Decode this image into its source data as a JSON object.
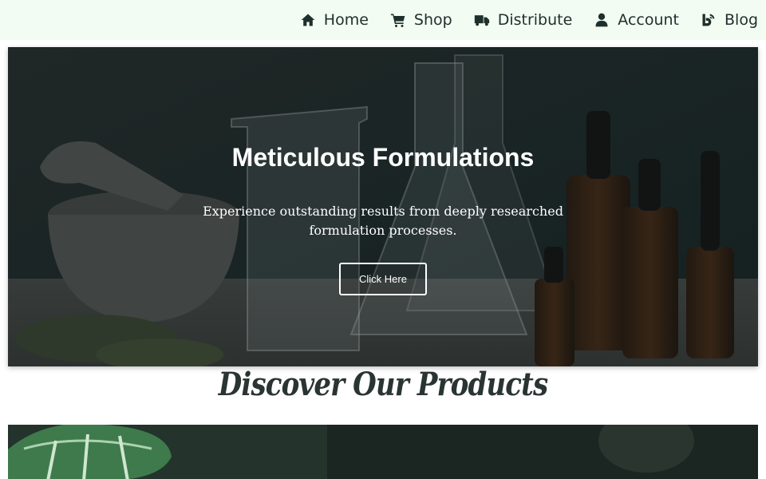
{
  "nav": {
    "items": [
      {
        "label": "Home",
        "icon": "home-icon"
      },
      {
        "label": "Shop",
        "icon": "cart-icon"
      },
      {
        "label": "Distribute",
        "icon": "truck-icon"
      },
      {
        "label": "Account",
        "icon": "user-icon"
      },
      {
        "label": "Blog",
        "icon": "rss-icon"
      }
    ]
  },
  "hero": {
    "title": "Meticulous Formulations",
    "subtitle": "Experience outstanding results from deeply researched formulation processes.",
    "button_label": "Click Here"
  },
  "products": {
    "heading": "Discover Our Products"
  },
  "colors": {
    "topbar_bg": "#f2fcf3",
    "nav_text": "#1f2f2b",
    "heading_text": "#2a3433"
  }
}
